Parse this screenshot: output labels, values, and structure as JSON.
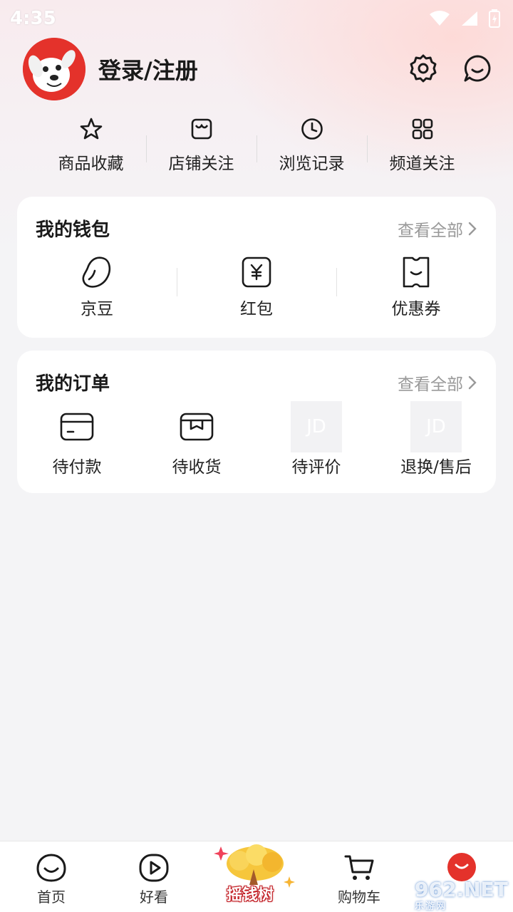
{
  "status_bar": {
    "time": "4:35"
  },
  "header": {
    "login_label": "登录/注册"
  },
  "shortcuts": [
    {
      "label": "商品收藏",
      "icon": "star-icon"
    },
    {
      "label": "店铺关注",
      "icon": "store-icon"
    },
    {
      "label": "浏览记录",
      "icon": "clock-icon"
    },
    {
      "label": "频道关注",
      "icon": "grid-icon"
    }
  ],
  "wallet": {
    "title": "我的钱包",
    "more": "查看全部",
    "items": [
      {
        "label": "京豆",
        "icon": "bean-icon"
      },
      {
        "label": "红包",
        "icon": "red-envelope-icon"
      },
      {
        "label": "优惠券",
        "icon": "coupon-icon"
      }
    ]
  },
  "orders": {
    "title": "我的订单",
    "more": "查看全部",
    "items": [
      {
        "label": "待付款",
        "icon": "card-icon"
      },
      {
        "label": "待收货",
        "icon": "box-icon"
      },
      {
        "label": "待评价",
        "icon": "jd-placeholder-icon",
        "placeholder_text": "JD"
      },
      {
        "label": "退换/售后",
        "icon": "jd-placeholder-icon",
        "placeholder_text": "JD"
      }
    ]
  },
  "bottom_nav": {
    "items": [
      {
        "label": "首页",
        "icon": "home-face-icon"
      },
      {
        "label": "好看",
        "icon": "play-icon"
      },
      {
        "label": "摇钱树",
        "icon": "money-tree-icon"
      },
      {
        "label": "购物车",
        "icon": "cart-icon"
      },
      {
        "label": "",
        "icon": "me-face-icon"
      }
    ]
  },
  "watermark": {
    "text": "962",
    "suffix": ".NET",
    "sub": "乐游网"
  },
  "colors": {
    "brand_red": "#e4322b",
    "background": "#f4f4f6",
    "muted_text": "#999999"
  }
}
